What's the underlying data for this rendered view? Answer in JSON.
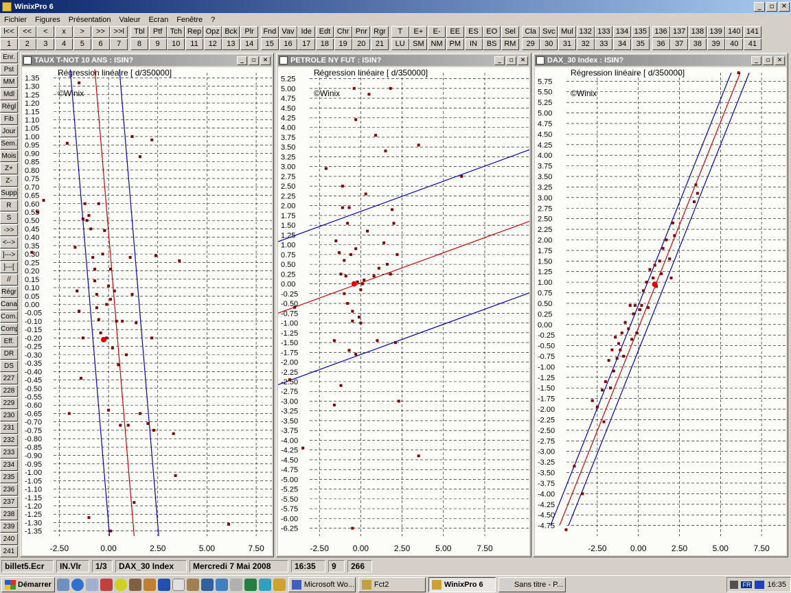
{
  "app": {
    "title": "WinixPro 6",
    "window_controls": [
      "_",
      "▫",
      "✕"
    ]
  },
  "menu": [
    "Fichier",
    "Figures",
    "Présentation",
    "Valeur",
    "Ecran",
    "Fenêtre",
    "?"
  ],
  "toolbar": {
    "groups": [
      {
        "top": [
          "l<<",
          "<<",
          "<",
          "x",
          ">",
          ">>",
          ">>l"
        ],
        "bottom": [
          "1",
          "2",
          "3",
          "4",
          "5",
          "6",
          "7"
        ]
      },
      {
        "top": [
          "Tbl",
          "Ptf",
          "Tch",
          "Rep",
          "Opz",
          "Bck",
          "Plr"
        ],
        "bottom": [
          "8",
          "9",
          "10",
          "11",
          "12",
          "13",
          "14"
        ]
      },
      {
        "top": [
          "Fnd",
          "Vav",
          "Ide",
          "Edt",
          "Chr",
          "Pnr",
          "Rgr"
        ],
        "bottom": [
          "15",
          "16",
          "17",
          "18",
          "19",
          "20",
          "21"
        ]
      },
      {
        "top": [
          "T",
          "E+",
          "E-",
          "EE",
          "ES",
          "EO",
          "Sel"
        ],
        "bottom": [
          "LU",
          "SM",
          "NM",
          "PM",
          "IN",
          "BS",
          "RM"
        ]
      },
      {
        "top": [
          "Cla",
          "Svc",
          "Mul",
          "132",
          "133",
          "134",
          "135"
        ],
        "bottom": [
          "29",
          "30",
          "31",
          "32",
          "33",
          "34",
          "35"
        ]
      },
      {
        "top": [
          "136",
          "137",
          "138",
          "139",
          "140",
          "141"
        ],
        "bottom": [
          "36",
          "37",
          "38",
          "39",
          "40",
          "41"
        ]
      }
    ]
  },
  "left_toolbar": [
    "Enr.",
    "Pst",
    "MM",
    "Mdl",
    "Règl",
    "Fib",
    "Jour",
    "Sem.",
    "Mois",
    "Z+",
    "Z-",
    "Supp",
    "R",
    "S",
    "->>",
    "<-->",
    "]--->",
    "]---[",
    "//",
    "Régr",
    "Canal",
    "Com.",
    "Comp",
    "Eff.",
    "DR",
    "DS",
    "227",
    "228",
    "229",
    "230",
    "231",
    "232",
    "233",
    "234",
    "235",
    "236",
    "237",
    "238",
    "239",
    "240",
    "241"
  ],
  "status": {
    "file": "billet5.Ecr",
    "mode": "IN.Vlr",
    "page": "1/3",
    "security": "DAX_30 Index",
    "date": "Mercredi 7 Mai 2008",
    "time": "16:35",
    "count_a": "9",
    "count_b": "266"
  },
  "taskbar": {
    "start": "Démarrer",
    "tasks": [
      "Microsoft Wo...",
      "Fct2",
      "WinixPro 6",
      "Sans titre - P..."
    ],
    "lang": "FR",
    "clock": "16:35"
  },
  "chart_data": [
    {
      "type": "scatter",
      "window_title": "TAUX T-NOT 10 ANS : ISIN?",
      "title": "Régression linéaire  [ d/350000]",
      "watermark": "©Winix",
      "xlim": [
        -4.4,
        8.3
      ],
      "ylim": [
        -1.38,
        1.38
      ],
      "ytick_step": 0.05,
      "yticks_major": [
        -1.35,
        1.35
      ],
      "xticks": [
        -2.5,
        0,
        2.5,
        5,
        7.5
      ],
      "xtick_labels": [
        "-2.50",
        "0.00",
        "2.50",
        "5.00",
        "7.50"
      ],
      "grid": true,
      "regression": {
        "x1": -0.7,
        "y1": 1.4,
        "x2": 1.3,
        "y2": -1.38,
        "band_offset_x": 1.25
      },
      "highlight": {
        "x": -0.25,
        "y": -0.21
      },
      "points": [
        [
          -3.9,
          0.31
        ],
        [
          -3.6,
          0.55
        ],
        [
          -3.3,
          0.62
        ],
        [
          -2.1,
          0.96
        ],
        [
          -1.5,
          1.32
        ],
        [
          -1.7,
          0.34
        ],
        [
          -1.6,
          0.08
        ],
        [
          -1.5,
          -0.04
        ],
        [
          -1.4,
          -0.44
        ],
        [
          -1.3,
          0.51
        ],
        [
          -1.2,
          0.6
        ],
        [
          -1.1,
          0.5
        ],
        [
          -1.0,
          0.53
        ],
        [
          -0.9,
          0.45
        ],
        [
          -0.8,
          0.28
        ],
        [
          -0.7,
          0.21
        ],
        [
          -0.7,
          0.14
        ],
        [
          -0.6,
          0.06
        ],
        [
          -0.6,
          -0.02
        ],
        [
          -0.5,
          0.6
        ],
        [
          -0.5,
          -0.09
        ],
        [
          -0.4,
          -0.17
        ],
        [
          -0.3,
          0.3
        ],
        [
          -0.2,
          0.44
        ],
        [
          -0.1,
          0.0
        ],
        [
          -0.1,
          -0.2
        ],
        [
          0,
          0.11
        ],
        [
          0,
          -0.63
        ],
        [
          0.1,
          0.21
        ],
        [
          0.1,
          0.03
        ],
        [
          0.2,
          -0.26
        ],
        [
          0.3,
          0.08
        ],
        [
          0.4,
          -0.1
        ],
        [
          0.5,
          -0.36
        ],
        [
          0.6,
          -0.72
        ],
        [
          0.7,
          -0.1
        ],
        [
          0.9,
          -0.3
        ],
        [
          1.0,
          -0.72
        ],
        [
          1.1,
          0.28
        ],
        [
          1.2,
          0.06
        ],
        [
          1.2,
          1.0
        ],
        [
          1.4,
          -0.11
        ],
        [
          1.6,
          0.88
        ],
        [
          1.6,
          -0.65
        ],
        [
          2.0,
          -0.71
        ],
        [
          2.2,
          0.98
        ],
        [
          2.2,
          -0.2
        ],
        [
          2.3,
          -0.75
        ],
        [
          2.4,
          0.29
        ],
        [
          3.3,
          -0.77
        ],
        [
          3.4,
          -1.02
        ],
        [
          3.6,
          0.26
        ],
        [
          -2.0,
          -0.65
        ],
        [
          -1.0,
          -1.27
        ],
        [
          0.1,
          -1.35
        ],
        [
          1.3,
          -1.18
        ],
        [
          6.1,
          -1.31
        ],
        [
          -1.3,
          -0.2
        ]
      ]
    },
    {
      "type": "scatter",
      "window_title": "PETROLE NY FUT : ISIN?",
      "title": "Régression linéaire  [ d/350000]",
      "watermark": "©Winix",
      "xlim": [
        -5.0,
        10.2
      ],
      "ylim": [
        -6.45,
        5.4
      ],
      "ytick_step": 0.25,
      "yticks_major": [
        -6.25,
        5.25
      ],
      "xticks": [
        -2.5,
        0,
        2.5,
        5,
        7.5
      ],
      "xtick_labels": [
        "-2.50",
        "0.00",
        "2.50",
        "5.00",
        "7.50"
      ],
      "grid": true,
      "regression": {
        "x1": -5.0,
        "y1": -0.75,
        "x2": 10.2,
        "y2": 1.6,
        "band_offset_y": 1.83
      },
      "highlight": {
        "x": -0.4,
        "y": 0.0
      },
      "points": [
        [
          -4.0,
          -0.6
        ],
        [
          -4.3,
          -2.45
        ],
        [
          -3.5,
          -4.2
        ],
        [
          -2.1,
          2.95
        ],
        [
          -1.6,
          -3.1
        ],
        [
          -1.2,
          -2.6
        ],
        [
          -1.1,
          2.5
        ],
        [
          -1.1,
          1.95
        ],
        [
          -1.5,
          1.1
        ],
        [
          -1.2,
          0.25
        ],
        [
          -1.0,
          -0.25
        ],
        [
          -1.3,
          0.8
        ],
        [
          -1.0,
          0.6
        ],
        [
          -0.9,
          0.2
        ],
        [
          -0.8,
          -0.5
        ],
        [
          -0.8,
          1.55
        ],
        [
          -0.7,
          1.95
        ],
        [
          -0.6,
          0.75
        ],
        [
          -0.5,
          -0.7
        ],
        [
          -0.5,
          -0.95
        ],
        [
          -0.4,
          5.0
        ],
        [
          -0.3,
          4.2
        ],
        [
          -0.3,
          0.9
        ],
        [
          -0.3,
          -1.8
        ],
        [
          -0.2,
          0.05
        ],
        [
          -0.1,
          -0.85
        ],
        [
          0,
          -0.15
        ],
        [
          0,
          -1.0
        ],
        [
          0.1,
          0.0
        ],
        [
          0.2,
          0.1
        ],
        [
          0.3,
          2.3
        ],
        [
          0.4,
          1.35
        ],
        [
          0.5,
          4.85
        ],
        [
          0.8,
          0.2
        ],
        [
          0.9,
          3.8
        ],
        [
          1.0,
          -1.45
        ],
        [
          1.1,
          0.4
        ],
        [
          1.4,
          1.05
        ],
        [
          1.5,
          3.4
        ],
        [
          1.6,
          0.5
        ],
        [
          1.8,
          0.25
        ],
        [
          2.0,
          1.55
        ],
        [
          2.2,
          0.75
        ],
        [
          1.8,
          5.0
        ],
        [
          2.1,
          -1.5
        ],
        [
          2.3,
          -3.0
        ],
        [
          3.5,
          3.55
        ],
        [
          3.5,
          -4.4
        ],
        [
          6.1,
          2.75
        ],
        [
          -0.5,
          -6.25
        ],
        [
          -1.6,
          -1.45
        ],
        [
          -0.7,
          -1.7
        ],
        [
          1.9,
          1.9
        ]
      ]
    },
    {
      "type": "scatter",
      "window_title": "DAX_30 Index : ISIN?",
      "title": "Régression linéaire  [ d/350000]",
      "watermark": "©Winix",
      "xlim": [
        -6.3,
        9.0
      ],
      "ylim": [
        -5.0,
        5.95
      ],
      "ytick_step": 0.25,
      "yticks_major": [
        -4.75,
        5.75
      ],
      "xticks": [
        -2.5,
        0,
        2.5,
        5,
        7.5
      ],
      "xtick_labels": [
        "-2.50",
        "0.00",
        "2.50",
        "5.00",
        "7.50"
      ],
      "grid": true,
      "regression": {
        "x1": -4.8,
        "y1": -4.75,
        "x2": 6.2,
        "y2": 5.95,
        "band_offset_x": 0.55
      },
      "highlight": {
        "x": 1.0,
        "y": 0.95
      },
      "points": [
        [
          -4.4,
          -4.85
        ],
        [
          -3.9,
          -3.35
        ],
        [
          -3.4,
          -4.0
        ],
        [
          -2.8,
          -1.8
        ],
        [
          -2.5,
          -1.95
        ],
        [
          -2.2,
          -1.55
        ],
        [
          -2.0,
          -1.35
        ],
        [
          -1.8,
          -0.85
        ],
        [
          -1.6,
          -0.6
        ],
        [
          -1.5,
          -1.1
        ],
        [
          -1.4,
          -0.3
        ],
        [
          -1.2,
          -0.45
        ],
        [
          -1.1,
          -0.6
        ],
        [
          -1.0,
          -0.2
        ],
        [
          -0.9,
          -0.75
        ],
        [
          -0.8,
          0.05
        ],
        [
          -0.6,
          -0.1
        ],
        [
          -0.5,
          0.45
        ],
        [
          -0.4,
          -0.35
        ],
        [
          -0.3,
          0.25
        ],
        [
          -0.2,
          0.45
        ],
        [
          -0.1,
          -0.2
        ],
        [
          0.1,
          0.35
        ],
        [
          0.2,
          0.45
        ],
        [
          0.3,
          0.8
        ],
        [
          0.5,
          1.0
        ],
        [
          0.6,
          0.4
        ],
        [
          0.7,
          1.3
        ],
        [
          0.9,
          1.1
        ],
        [
          1.0,
          1.4
        ],
        [
          1.1,
          0.9
        ],
        [
          1.3,
          1.5
        ],
        [
          1.4,
          1.2
        ],
        [
          1.5,
          1.8
        ],
        [
          1.7,
          2.0
        ],
        [
          1.9,
          1.55
        ],
        [
          2.0,
          1.1
        ],
        [
          2.1,
          2.4
        ],
        [
          2.2,
          2.1
        ],
        [
          3.5,
          3.3
        ],
        [
          3.4,
          2.9
        ],
        [
          3.6,
          3.1
        ],
        [
          6.1,
          5.95
        ],
        [
          -2.1,
          -2.3
        ],
        [
          -1.7,
          -1.5
        ],
        [
          -1.3,
          -0.8
        ]
      ]
    }
  ]
}
